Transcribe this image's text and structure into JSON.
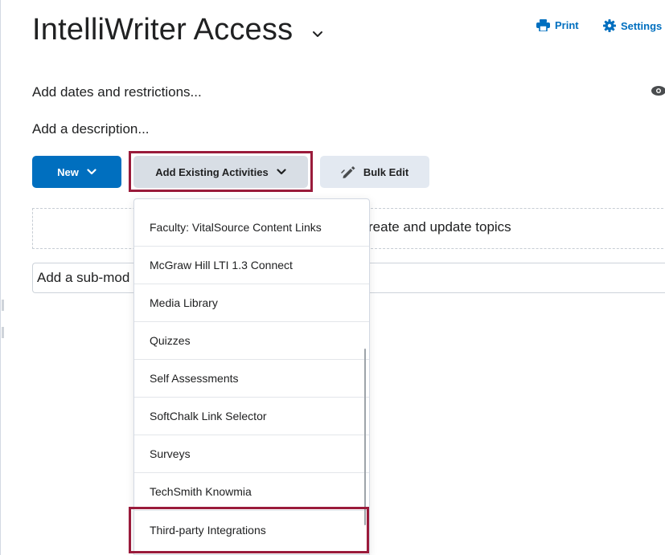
{
  "page": {
    "title": "IntelliWriter Access",
    "print_label": "Print",
    "settings_label": "Settings",
    "dates_link": "Add dates and restrictions...",
    "description_link": "Add a description..."
  },
  "toolbar": {
    "new_label": "New",
    "add_existing_label": "Add Existing Activities",
    "bulk_edit_label": "Bulk Edit"
  },
  "dropzone": {
    "text": "reate and update topics"
  },
  "submodule": {
    "placeholder": "Add a sub-mod"
  },
  "menu": {
    "items": [
      "Faculty: VitalSource Content Links",
      "McGraw Hill LTI 1.3 Connect",
      "Media Library",
      "Quizzes",
      "Self Assessments",
      "SoftChalk Link Selector",
      "Surveys",
      "TechSmith Knowmia",
      "Third-party Integrations"
    ]
  },
  "colors": {
    "accent": "#006fbf",
    "highlight": "#9a1b3b",
    "button_gray": "#e3e9f1"
  },
  "icons": {
    "title_dropdown": "chevron-down-icon",
    "print": "printer-icon",
    "settings": "gear-icon",
    "visibility": "eye-icon",
    "new_dropdown": "chevron-down-icon",
    "existing_dropdown": "chevron-down-icon",
    "bulk_edit": "pencil-icon"
  }
}
